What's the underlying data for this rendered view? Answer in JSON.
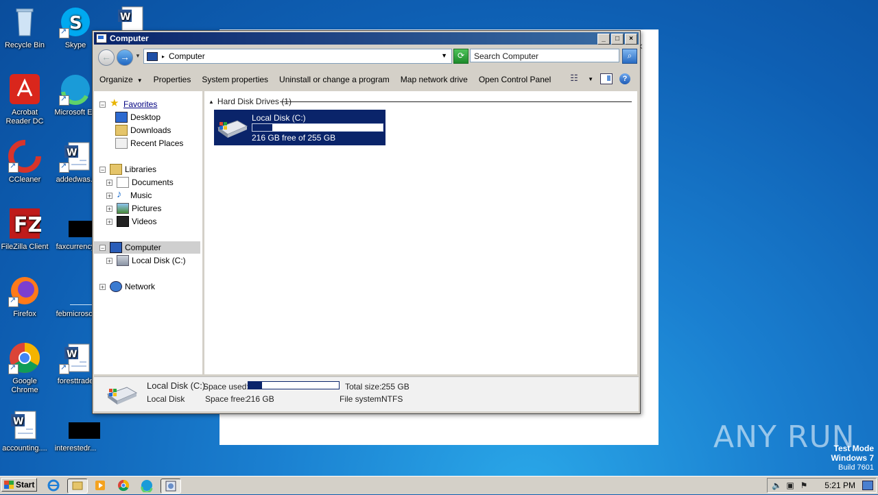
{
  "desktop": {
    "icons": [
      {
        "label": "Recycle Bin",
        "icon": "recycle-bin-icon"
      },
      {
        "label": "Skype",
        "icon": "skype-icon"
      },
      {
        "label": "Acrobat Reader DC",
        "icon": "acrobat-icon"
      },
      {
        "label": "Microsoft Ed",
        "icon": "edge-icon"
      },
      {
        "label": "CCleaner",
        "icon": "ccleaner-icon"
      },
      {
        "label": "addedwas.r",
        "icon": "word-doc-icon"
      },
      {
        "label": "FileZilla Client",
        "icon": "filezilla-icon"
      },
      {
        "label": "faxcurrency",
        "icon": "black-thumbnail-icon"
      },
      {
        "label": "Firefox",
        "icon": "firefox-icon"
      },
      {
        "label": "febmicrosof",
        "icon": "blank-doc-icon"
      },
      {
        "label": "Google Chrome",
        "icon": "chrome-icon"
      },
      {
        "label": "foresttrade",
        "icon": "word-doc-icon"
      },
      {
        "label": "accounting....",
        "icon": "word-doc-icon"
      },
      {
        "label": "interestedr...",
        "icon": "black-thumbnail-icon"
      }
    ],
    "watermark": "ANY RUN",
    "test_mode": {
      "line1": "Test Mode",
      "line2": "Windows 7",
      "line3": "Build 7601"
    }
  },
  "window": {
    "title": "Computer",
    "controls": {
      "minimize": "_",
      "maximize": "□",
      "close": "×"
    },
    "address": {
      "path": "Computer",
      "search_placeholder": "Search Computer"
    },
    "commands": {
      "organize": "Organize",
      "properties": "Properties",
      "system_properties": "System properties",
      "uninstall": "Uninstall or change a program",
      "map_drive": "Map network drive",
      "control_panel": "Open Control Panel"
    },
    "nav": {
      "favorites": "Favorites",
      "desktop": "Desktop",
      "downloads": "Downloads",
      "recent": "Recent Places",
      "libraries": "Libraries",
      "documents": "Documents",
      "music": "Music",
      "pictures": "Pictures",
      "videos": "Videos",
      "computer": "Computer",
      "local_disk": "Local Disk (C:)",
      "network": "Network"
    },
    "content": {
      "group": "Hard Disk Drives (1)",
      "drive": {
        "name": "Local Disk (C:)",
        "free_text": "216 GB free of 255 GB",
        "used_fraction": 0.153
      }
    },
    "details": {
      "name": "Local Disk (C:)",
      "type": "Local Disk",
      "space_used_label": "Space used:",
      "space_free_label": "Space free:",
      "space_free": "216 GB",
      "total_size_label": "Total size:",
      "total_size": "255 GB",
      "file_system_label": "File system:",
      "file_system": "NTFS",
      "used_fraction": 0.153
    }
  },
  "taskbar": {
    "start": "Start",
    "clock": "5:21 PM"
  },
  "colors": {
    "selection": "#0a246a",
    "desktop": "#0e5fb3",
    "chrome": "#d4d0c8"
  }
}
